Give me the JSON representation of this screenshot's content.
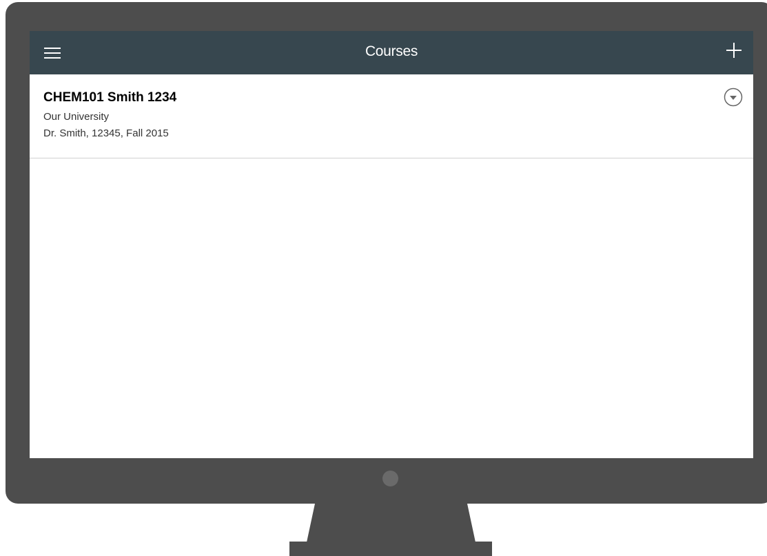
{
  "header": {
    "title": "Courses",
    "menu_icon": "hamburger-menu-icon",
    "add_icon": "plus-icon"
  },
  "courses": [
    {
      "title": "CHEM101 Smith 1234",
      "institution": "Our University",
      "details": "Dr. Smith, 12345, Fall 2015",
      "expand_icon": "chevron-down-circle-icon"
    }
  ],
  "colors": {
    "header_bg": "#37474f",
    "monitor": "#4d4d4d",
    "camera": "#6a6a6a"
  }
}
